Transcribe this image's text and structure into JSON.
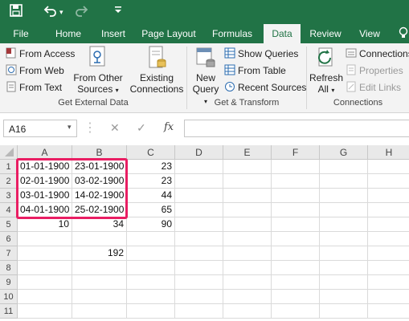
{
  "colors": {
    "brand": "#217346",
    "highlight": "#e91e63"
  },
  "qat": {
    "save_icon": "save-icon",
    "undo_icon": "undo-icon",
    "redo_icon": "redo-icon",
    "customize_icon": "customize-icon"
  },
  "tabs": [
    {
      "label": "File"
    },
    {
      "label": "Home"
    },
    {
      "label": "Insert"
    },
    {
      "label": "Page Layout"
    },
    {
      "label": "Formulas"
    },
    {
      "label": "Data"
    },
    {
      "label": "Review"
    },
    {
      "label": "View"
    }
  ],
  "ribbon": {
    "get_external": {
      "from_access": "From Access",
      "from_web": "From Web",
      "from_text": "From Text",
      "from_other_1": "From Other",
      "from_other_2": "Sources",
      "existing_1": "Existing",
      "existing_2": "Connections",
      "group_label": "Get External Data"
    },
    "get_transform": {
      "new_query_1": "New",
      "new_query_2": "Query",
      "show_queries": "Show Queries",
      "from_table": "From Table",
      "recent_sources": "Recent Sources",
      "group_label": "Get & Transform"
    },
    "connections": {
      "refresh_1": "Refresh",
      "refresh_2": "All",
      "connections": "Connections",
      "properties": "Properties",
      "edit_links": "Edit Links",
      "group_label": "Connections"
    }
  },
  "formula_bar": {
    "name_box": "A16",
    "fx": "fx",
    "value": ""
  },
  "grid": {
    "columns": [
      "A",
      "B",
      "C",
      "D",
      "E",
      "F",
      "G",
      "H"
    ],
    "rows": [
      {
        "n": "1",
        "cells": [
          "01-01-1900",
          "23-01-1900",
          "23"
        ]
      },
      {
        "n": "2",
        "cells": [
          "02-01-1900",
          "03-02-1900",
          "23"
        ]
      },
      {
        "n": "3",
        "cells": [
          "03-01-1900",
          "14-02-1900",
          "44"
        ]
      },
      {
        "n": "4",
        "cells": [
          "04-01-1900",
          "25-02-1900",
          "65"
        ]
      },
      {
        "n": "5",
        "cells": [
          "10",
          "34",
          "90"
        ]
      },
      {
        "n": "6",
        "cells": [
          "",
          "",
          ""
        ]
      },
      {
        "n": "7",
        "cells": [
          "",
          "192",
          ""
        ]
      },
      {
        "n": "8",
        "cells": [
          "",
          "",
          ""
        ]
      },
      {
        "n": "9",
        "cells": [
          "",
          "",
          ""
        ]
      },
      {
        "n": "10",
        "cells": [
          "",
          "",
          ""
        ]
      },
      {
        "n": "11",
        "cells": [
          "",
          "",
          ""
        ]
      }
    ]
  }
}
